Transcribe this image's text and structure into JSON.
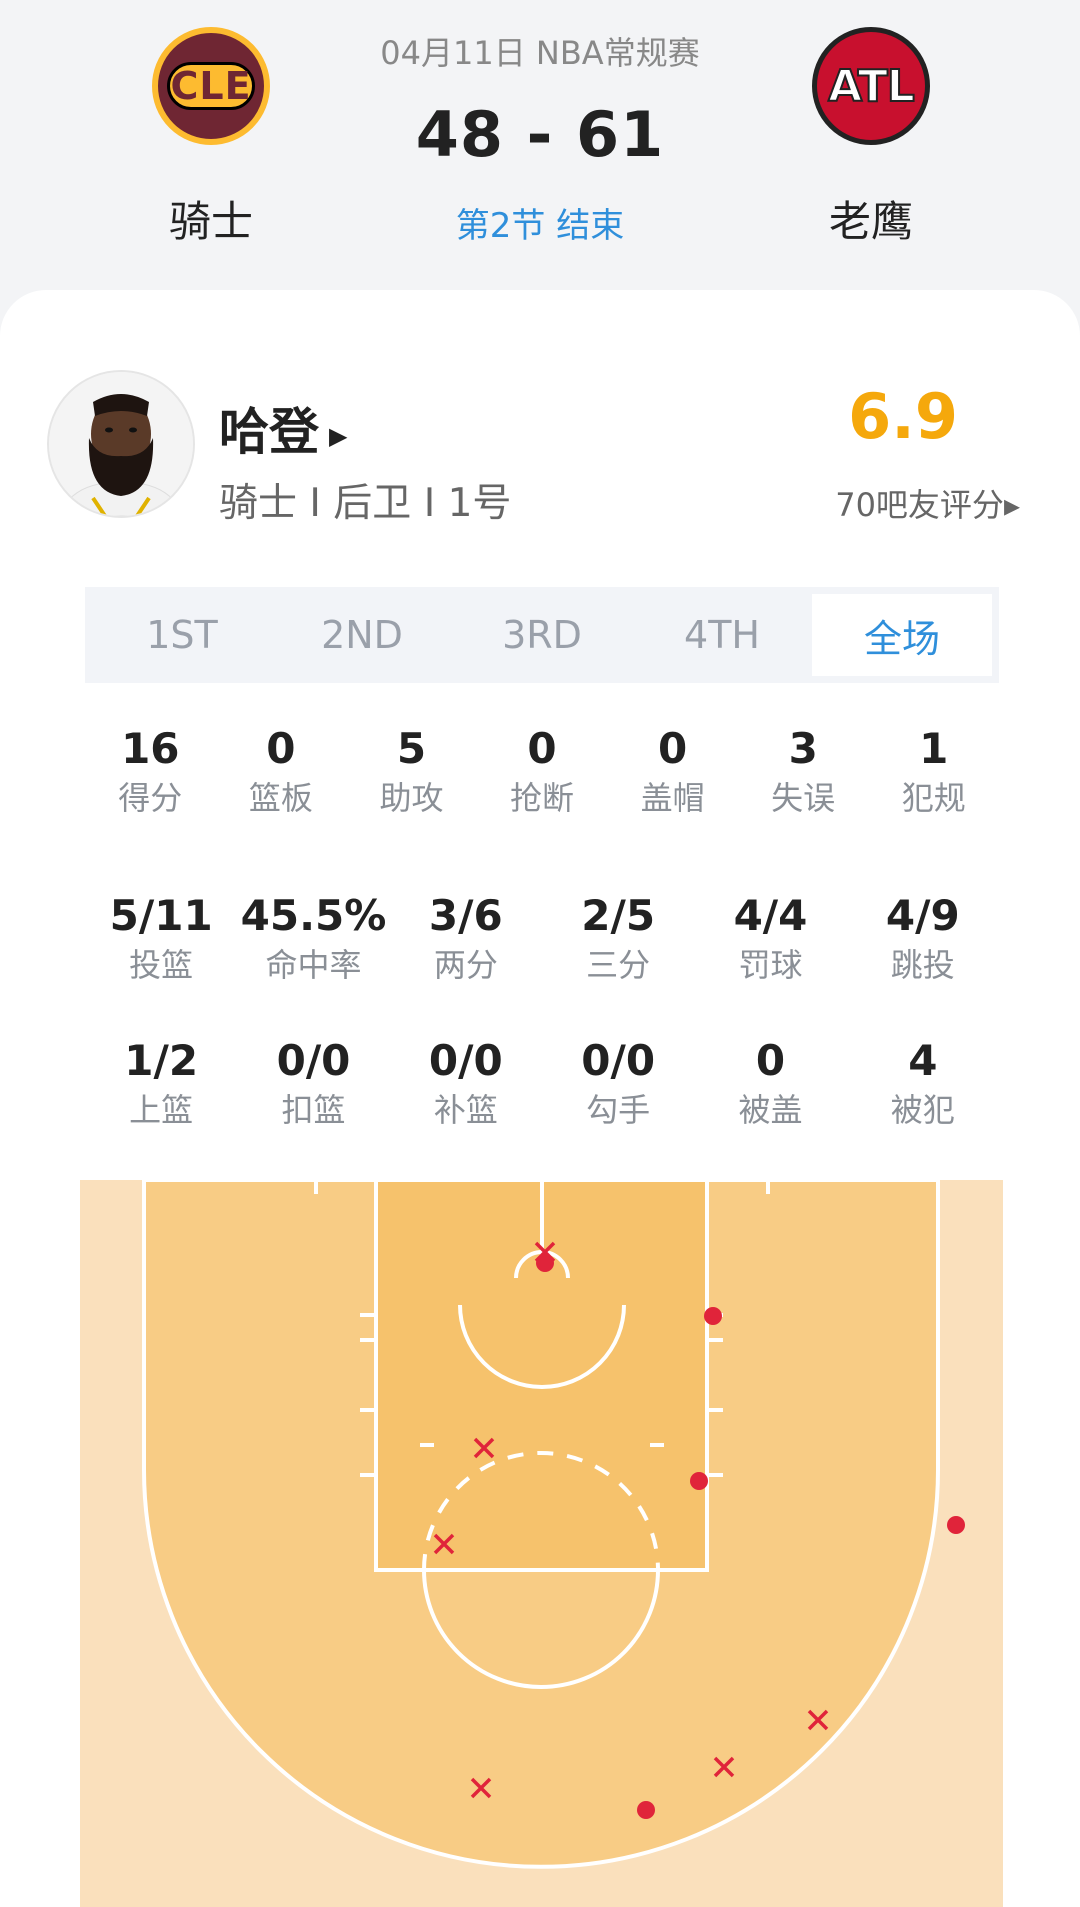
{
  "match": {
    "date_league": "04月11日 NBA常规赛",
    "score": "48 - 61",
    "period": "第2节 结束",
    "home": {
      "abbr": "CLE",
      "name": "骑士"
    },
    "away": {
      "abbr": "ATL",
      "name": "老鹰"
    }
  },
  "player": {
    "name": "哈登",
    "info": "骑士 I 后卫 I 1号",
    "rating": "6.9",
    "rating_label": "70吧友评分",
    "arrow": "▸"
  },
  "tabs": [
    {
      "label": "1ST",
      "active": false
    },
    {
      "label": "2ND",
      "active": false
    },
    {
      "label": "3RD",
      "active": false
    },
    {
      "label": "4TH",
      "active": false
    },
    {
      "label": "全场",
      "active": true
    }
  ],
  "stats_row1": [
    {
      "value": "16",
      "label": "得分"
    },
    {
      "value": "0",
      "label": "篮板"
    },
    {
      "value": "5",
      "label": "助攻"
    },
    {
      "value": "0",
      "label": "抢断"
    },
    {
      "value": "0",
      "label": "盖帽"
    },
    {
      "value": "3",
      "label": "失误"
    },
    {
      "value": "1",
      "label": "犯规"
    }
  ],
  "stats_row2": [
    {
      "value": "5/11",
      "label": "投篮"
    },
    {
      "value": "45.5%",
      "label": "命中率"
    },
    {
      "value": "3/6",
      "label": "两分"
    },
    {
      "value": "2/5",
      "label": "三分"
    },
    {
      "value": "4/4",
      "label": "罚球"
    },
    {
      "value": "4/9",
      "label": "跳投"
    }
  ],
  "stats_row3": [
    {
      "value": "1/2",
      "label": "上篮"
    },
    {
      "value": "0/0",
      "label": "扣篮"
    },
    {
      "value": "0/0",
      "label": "补篮"
    },
    {
      "value": "0/0",
      "label": "勾手"
    },
    {
      "value": "0",
      "label": "被盖"
    },
    {
      "value": "4",
      "label": "被犯"
    }
  ],
  "colors": {
    "accent": "#2f8fdb",
    "rating": "#f5a80c",
    "court_outer": "#fae0bc",
    "court_inner": "#f8cc85",
    "court_paint": "#f6c26c",
    "shot_mark": "#e0243a"
  },
  "shots": [
    {
      "result": "miss"
    },
    {
      "result": "make"
    },
    {
      "result": "make"
    },
    {
      "result": "miss"
    },
    {
      "result": "make"
    },
    {
      "result": "miss"
    },
    {
      "result": "make"
    },
    {
      "result": "miss"
    },
    {
      "result": "miss"
    },
    {
      "result": "miss"
    },
    {
      "result": "make"
    }
  ]
}
